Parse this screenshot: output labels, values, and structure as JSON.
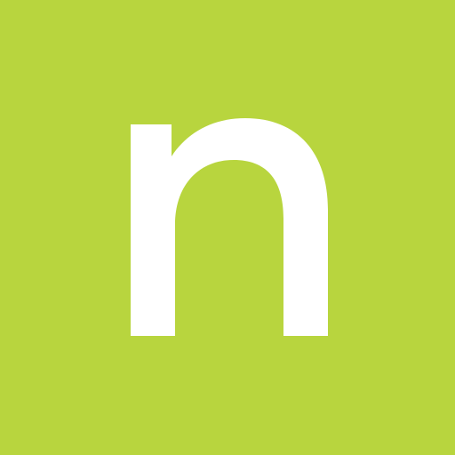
{
  "logo": {
    "letter": "n",
    "letter_color": "#ffffff"
  },
  "colors": {
    "background": "#b8d53e"
  }
}
